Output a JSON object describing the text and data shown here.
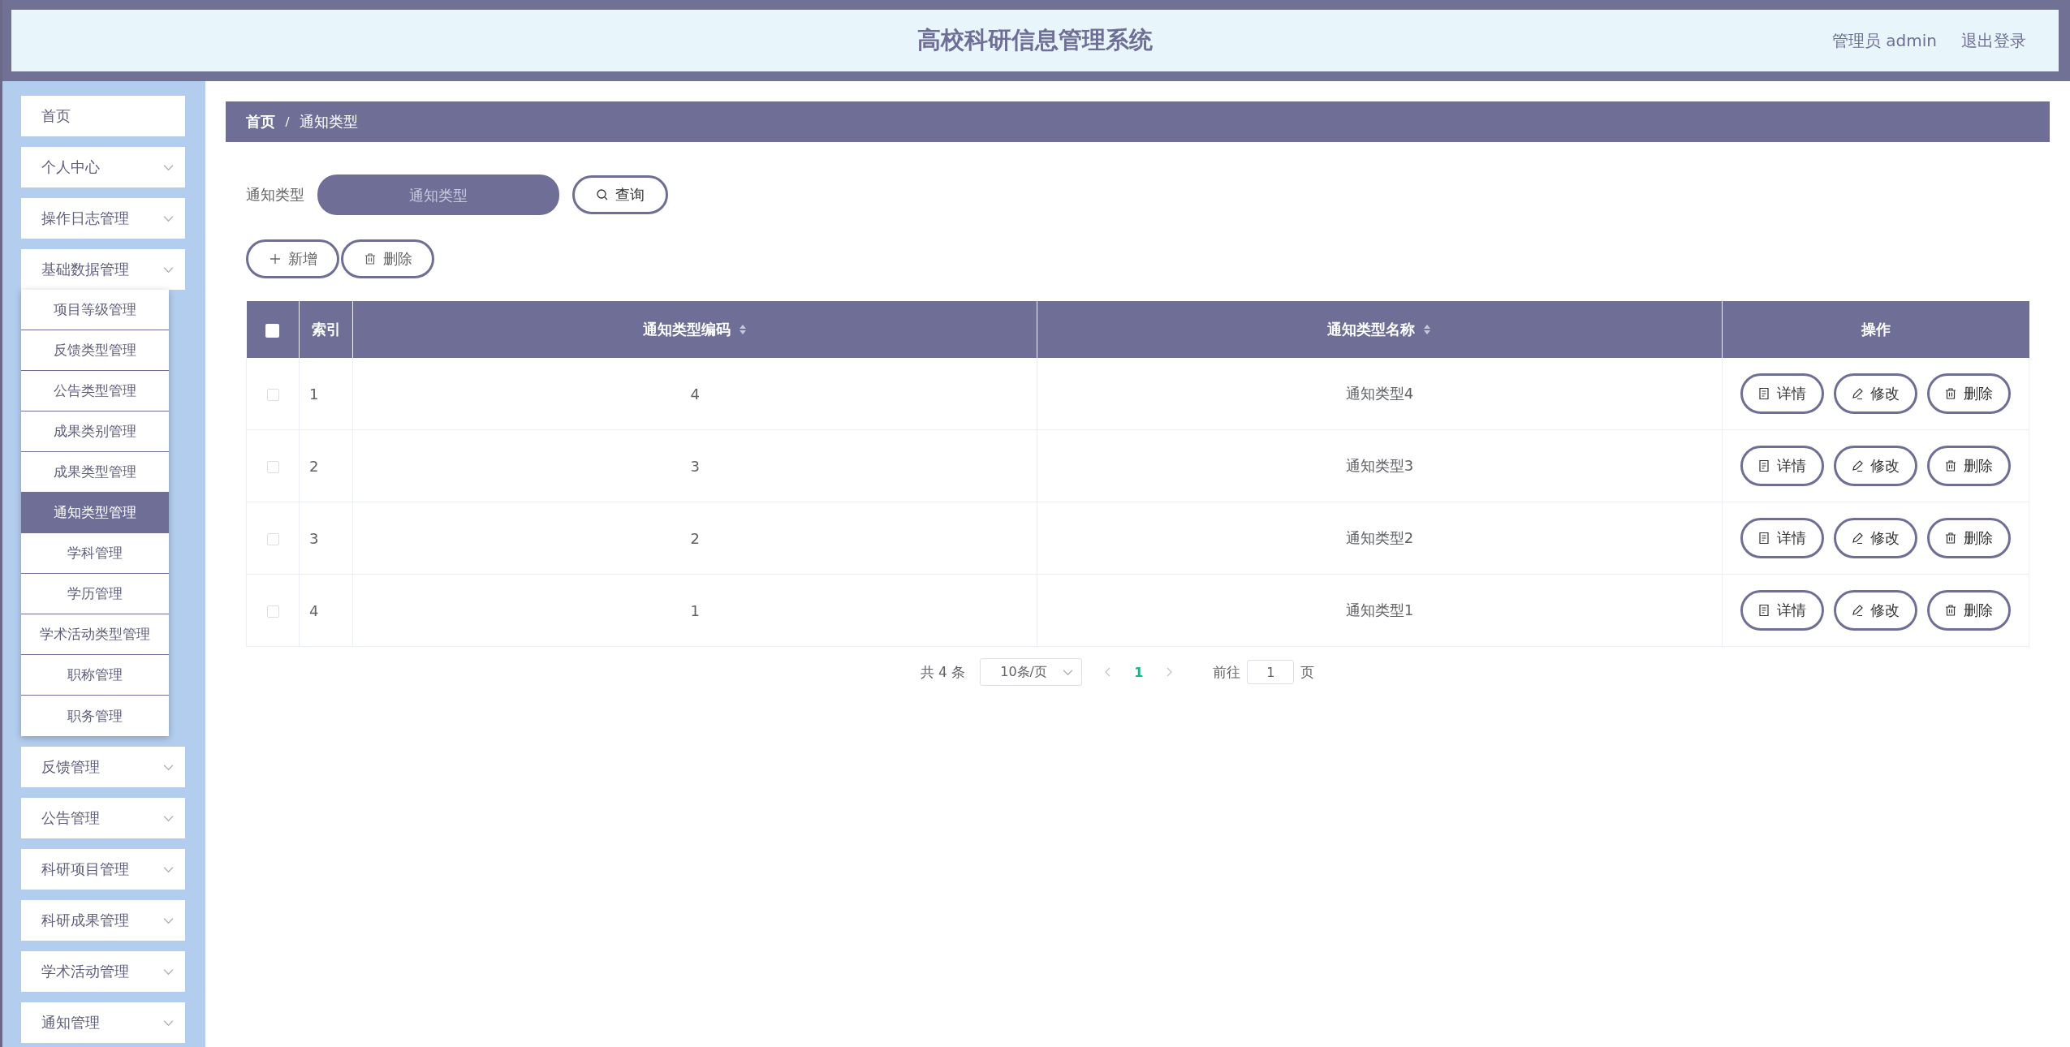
{
  "header": {
    "title": "高校科研信息管理系统",
    "user": "管理员 admin",
    "logout": "退出登录"
  },
  "sidebar": {
    "items": [
      {
        "label": "首页",
        "kind": "link"
      },
      {
        "label": "个人中心",
        "kind": "menu"
      },
      {
        "label": "操作日志管理",
        "kind": "menu"
      },
      {
        "label": "基础数据管理",
        "kind": "menu",
        "children": [
          {
            "label": "项目等级管理",
            "selected": false
          },
          {
            "label": "反馈类型管理",
            "selected": false
          },
          {
            "label": "公告类型管理",
            "selected": false
          },
          {
            "label": "成果类别管理",
            "selected": false
          },
          {
            "label": "成果类型管理",
            "selected": false
          },
          {
            "label": "通知类型管理",
            "selected": true
          },
          {
            "label": "学科管理",
            "selected": false
          },
          {
            "label": "学历管理",
            "selected": false
          },
          {
            "label": "学术活动类型管理",
            "selected": false
          },
          {
            "label": "职称管理",
            "selected": false
          },
          {
            "label": "职务管理",
            "selected": false
          }
        ]
      },
      {
        "label": "反馈管理",
        "kind": "menu"
      },
      {
        "label": "公告管理",
        "kind": "menu"
      },
      {
        "label": "科研项目管理",
        "kind": "menu"
      },
      {
        "label": "科研成果管理",
        "kind": "menu"
      },
      {
        "label": "学术活动管理",
        "kind": "menu"
      },
      {
        "label": "通知管理",
        "kind": "menu"
      }
    ]
  },
  "breadcrumb": [
    "首页",
    "通知类型"
  ],
  "search": {
    "label": "通知类型",
    "placeholder": "通知类型",
    "button": "查询"
  },
  "actions": [
    {
      "label": "新增",
      "kind": "add"
    },
    {
      "label": "删除",
      "kind": "delete"
    }
  ],
  "table": {
    "header_checked": false,
    "columns": [
      {
        "label": "索引",
        "sortable": false
      },
      {
        "label": "通知类型编码",
        "sortable": true
      },
      {
        "label": "通知类型名称",
        "sortable": true
      },
      {
        "label": "操作",
        "sortable": false
      }
    ],
    "rows": [
      {
        "checked": false,
        "index": "1",
        "code": "4",
        "name": "通知类型4",
        "buttons": [
          {
            "label": "详情",
            "kind": "detail"
          },
          {
            "label": "修改",
            "kind": "edit"
          },
          {
            "label": "删除",
            "kind": "delete"
          }
        ]
      },
      {
        "checked": false,
        "index": "2",
        "code": "3",
        "name": "通知类型3",
        "buttons": [
          {
            "label": "详情",
            "kind": "detail"
          },
          {
            "label": "修改",
            "kind": "edit"
          },
          {
            "label": "删除",
            "kind": "delete"
          }
        ]
      },
      {
        "checked": false,
        "index": "3",
        "code": "2",
        "name": "通知类型2",
        "buttons": [
          {
            "label": "详情",
            "kind": "detail"
          },
          {
            "label": "修改",
            "kind": "edit"
          },
          {
            "label": "删除",
            "kind": "delete"
          }
        ]
      },
      {
        "checked": false,
        "index": "4",
        "code": "1",
        "name": "通知类型1",
        "buttons": [
          {
            "label": "详情",
            "kind": "detail"
          },
          {
            "label": "修改",
            "kind": "edit"
          },
          {
            "label": "删除",
            "kind": "delete"
          }
        ]
      }
    ]
  },
  "pagination": {
    "total": "共 4 条",
    "page_size": "10条/页",
    "pages": [
      {
        "label": "1",
        "selected": true
      }
    ],
    "goto": "前往",
    "goto_value": "1",
    "page_unit": "页"
  }
}
